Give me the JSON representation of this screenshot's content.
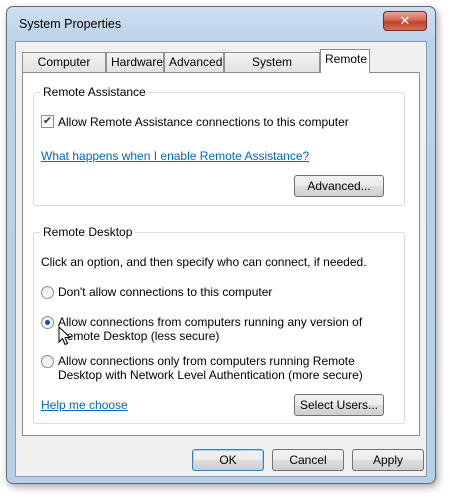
{
  "window": {
    "title": "System Properties",
    "close_glyph": "✕"
  },
  "tabs": [
    {
      "label": "Computer Name"
    },
    {
      "label": "Hardware"
    },
    {
      "label": "Advanced"
    },
    {
      "label": "System Protection"
    },
    {
      "label": "Remote"
    }
  ],
  "remote_assistance": {
    "group_label": "Remote Assistance",
    "allow_label": "Allow Remote Assistance connections to this computer",
    "allow_checked": true,
    "link": "What happens when I enable Remote Assistance?",
    "advanced_button": "Advanced..."
  },
  "remote_desktop": {
    "group_label": "Remote Desktop",
    "instruction": "Click an option, and then specify who can connect, if needed.",
    "options": [
      {
        "line1": "Don't allow connections to this computer",
        "line2": "",
        "checked": false
      },
      {
        "line1": "Allow connections from computers running any version of",
        "line2": "Remote Desktop (less secure)",
        "checked": true
      },
      {
        "line1": "Allow connections only from computers running Remote",
        "line2": "Desktop with Network Level Authentication (more secure)",
        "checked": false
      }
    ],
    "help_link": "Help me choose",
    "select_users_button": "Select Users..."
  },
  "footer": {
    "ok": "OK",
    "cancel": "Cancel",
    "apply": "Apply"
  },
  "icons": {
    "cursor": "arrow-cursor-icon"
  }
}
